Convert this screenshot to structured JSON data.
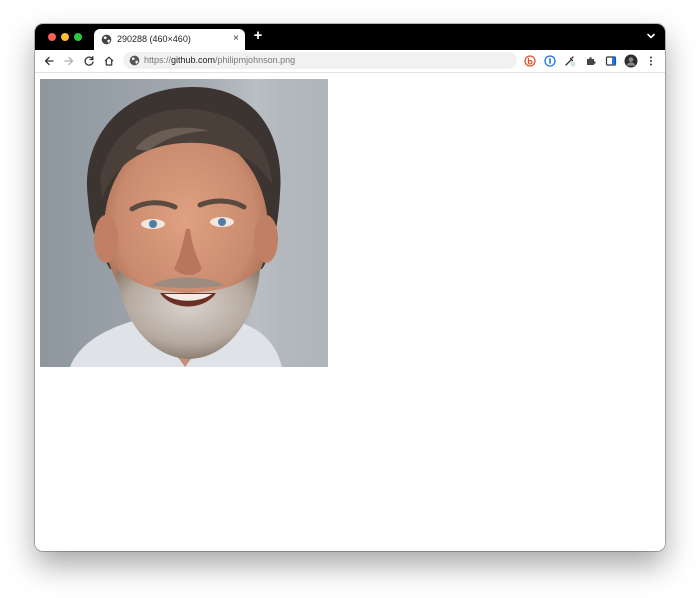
{
  "browser": {
    "tab": {
      "title": "290288 (460×460)",
      "favicon_icon": "globe-icon",
      "close_label": "×"
    },
    "new_tab_label": "+",
    "address_bar": {
      "scheme": "https://",
      "host": "github.com",
      "path": "/philipmjohnson.png",
      "security_icon": "globe-icon"
    },
    "nav_icons": [
      "back-arrow-icon",
      "forward-arrow-icon",
      "reload-icon",
      "home-icon"
    ],
    "extension_icons": [
      "orange-b-extension-icon",
      "password-manager-icon",
      "eyedropper-icon",
      "puzzle-icon",
      "sidebar-icon",
      "profile-avatar-icon",
      "kebab-menu-icon"
    ]
  },
  "content": {
    "image_description": "portrait photo"
  },
  "colors": {
    "tabstrip": "#000000",
    "omnibox": "#f1f1f1",
    "traffic_red": "#fe5f57",
    "traffic_yellow": "#febc2e",
    "traffic_green": "#28c840"
  }
}
